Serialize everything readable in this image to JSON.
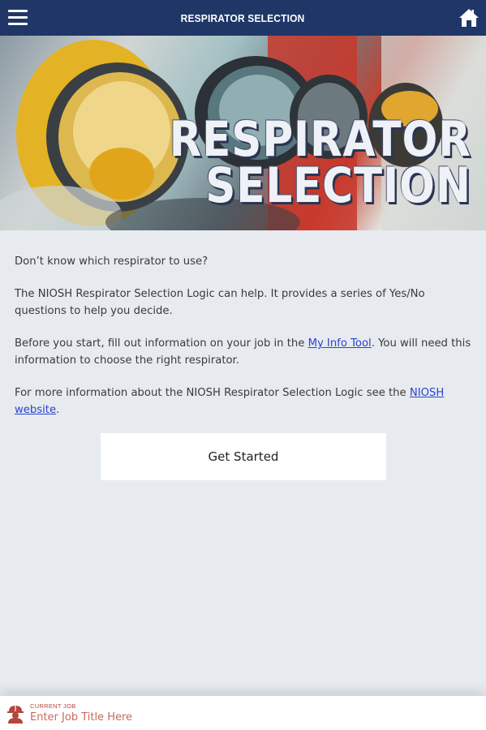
{
  "header": {
    "title": "RESPIRATOR SELECTION",
    "menu_icon": "hamburger-menu-icon",
    "home_icon": "home-icon"
  },
  "hero": {
    "line1": "RESPIRATOR",
    "line2": "SELECTION"
  },
  "content": {
    "p1": "Don’t know which respirator to use?",
    "p2": "The NIOSH Respirator Selection Logic can help. It provides a series of Yes/No questions to help you decide.",
    "p3_before": "Before you start, fill out information on your job in the ",
    "p3_link": "My Info Tool",
    "p3_after": ". You will need this information to choose the right respirator.",
    "p4_before": "For more information about the NIOSH Respirator Selection Logic see the ",
    "p4_link": "NIOSH website",
    "p4_after": ".",
    "button": "Get Started"
  },
  "footer": {
    "label": "CURRENT JOB",
    "placeholder": "Enter Job Title Here",
    "icon": "worker-hardhat-icon"
  },
  "colors": {
    "header_bg": "#1f3667",
    "page_bg": "#e7ebef",
    "link": "#2a43d1",
    "footer_accent": "#b2473e"
  }
}
